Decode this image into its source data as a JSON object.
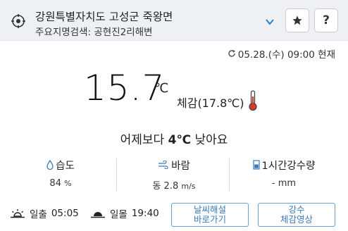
{
  "location": {
    "name": "강원특별자치도 고성군 죽왕면",
    "landmark": "주요지명검색: 공현진2리해변"
  },
  "header_buttons": {
    "favorite_icon": "star-icon",
    "help_label": "?"
  },
  "observation_time": "05.28.(수) 09:00 현재",
  "current": {
    "temperature": "15.7",
    "unit": "℃",
    "feels_like": "체감(17.8℃)",
    "compare_prefix": "어제보다",
    "compare_value": "4℃",
    "compare_suffix": "낮아요"
  },
  "stats": {
    "humidity": {
      "label": "습도",
      "value": "84",
      "unit": "%"
    },
    "wind": {
      "label": "바람",
      "value": "동 2.8",
      "unit": "m/s"
    },
    "rain": {
      "label": "1시간강수량",
      "value": "- mm"
    }
  },
  "sun": {
    "sunrise_label": "일출",
    "sunrise_time": "05:05",
    "sunset_label": "일몰",
    "sunset_time": "19:40"
  },
  "buttons": {
    "commentary_line1": "날씨해설",
    "commentary_line2": "바로가기",
    "video_line1": "강수",
    "video_line2": "체감영상"
  },
  "colors": {
    "accent_blue": "#3a79bd",
    "thermo_red": "#d33a2c",
    "chevron": "#1f7fd6"
  }
}
